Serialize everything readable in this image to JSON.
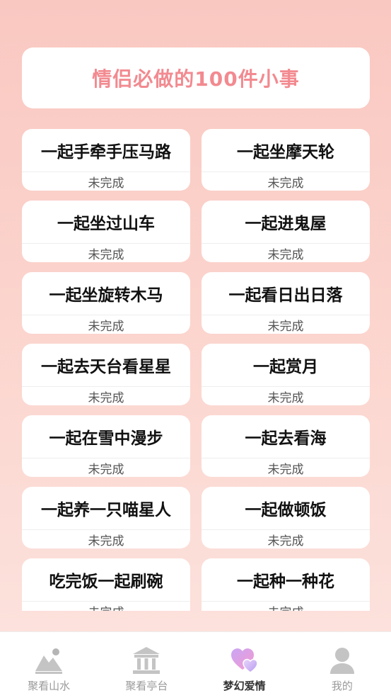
{
  "header": {
    "title": "情侣必做的100件小事"
  },
  "tasks": [
    {
      "name": "一起手牵手压马路",
      "status": "未完成"
    },
    {
      "name": "一起坐摩天轮",
      "status": "未完成"
    },
    {
      "name": "一起坐过山车",
      "status": "未完成"
    },
    {
      "name": "一起进鬼屋",
      "status": "未完成"
    },
    {
      "name": "一起坐旋转木马",
      "status": "未完成"
    },
    {
      "name": "一起看日出日落",
      "status": "未完成"
    },
    {
      "name": "一起去天台看星星",
      "status": "未完成"
    },
    {
      "name": "一起赏月",
      "status": "未完成"
    },
    {
      "name": "一起在雪中漫步",
      "status": "未完成"
    },
    {
      "name": "一起去看海",
      "status": "未完成"
    },
    {
      "name": "一起养一只喵星人",
      "status": "未完成"
    },
    {
      "name": "一起做顿饭",
      "status": "未完成"
    },
    {
      "name": "吃完饭一起刷碗",
      "status": "未完成"
    },
    {
      "name": "一起种一种花",
      "status": "未完成"
    }
  ],
  "tabbar": {
    "tabs": [
      {
        "label": "聚看山水",
        "icon": "mountain-icon"
      },
      {
        "label": "聚看亭台",
        "icon": "pavilion-icon"
      },
      {
        "label": "梦幻爱情",
        "icon": "hearts-icon"
      },
      {
        "label": "我的",
        "icon": "person-icon"
      }
    ],
    "active_index": 2,
    "active_color": "#333333",
    "inactive_color": "#9a9a9a"
  }
}
